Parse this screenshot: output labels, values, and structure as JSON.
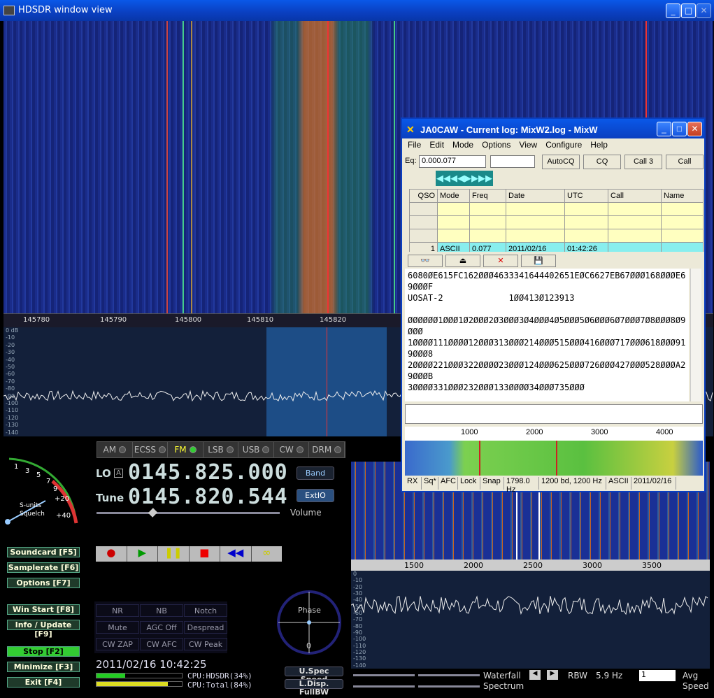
{
  "window": {
    "title": "HDSDR window view"
  },
  "waterfall_scale": [
    "145780",
    "145790",
    "145800",
    "145810",
    "145820"
  ],
  "spectrum_axis": [
    "0 dB",
    "-10",
    "-20",
    "-30",
    "-40",
    "-50",
    "-60",
    "-70",
    "-80",
    "-90",
    "-100",
    "-110",
    "-120",
    "-130",
    "-140"
  ],
  "modes": [
    {
      "label": "AM",
      "active": false
    },
    {
      "label": "ECSS",
      "active": false
    },
    {
      "label": "FM",
      "active": true
    },
    {
      "label": "LSB",
      "active": false
    },
    {
      "label": "USB",
      "active": false
    },
    {
      "label": "CW",
      "active": false
    },
    {
      "label": "DRM",
      "active": false
    }
  ],
  "lo": {
    "label": "LO",
    "lock": "A",
    "value": "0145.825.000"
  },
  "tune": {
    "label": "Tune",
    "value": "0145.820.544"
  },
  "band_button": "Band",
  "extio_button": "ExtIO",
  "volume_label": "Volume",
  "smeter": {
    "label1": "S-units",
    "label2": "Squelch",
    "scale": [
      "1",
      "3",
      "5",
      "7",
      "9",
      "+20",
      "+40"
    ]
  },
  "side_buttons": [
    {
      "label": "Soundcard  [F5]"
    },
    {
      "label": "Samplerate  [F6]"
    },
    {
      "label": "Options  [F7]"
    },
    {
      "label": "Win Start  [F8]"
    },
    {
      "label": "Info / Update  [F9]"
    },
    {
      "label": "Stop  [F2]"
    },
    {
      "label": "Minimize  [F3]"
    },
    {
      "label": "Exit  [F4]"
    }
  ],
  "dsp": [
    [
      "NR",
      "NB",
      "Notch"
    ],
    [
      "Mute",
      "AGC Off",
      "Despread"
    ],
    [
      "CW ZAP",
      "CW AFC",
      "CW Peak"
    ]
  ],
  "phase": {
    "label": "Phase",
    "zero": "0"
  },
  "datetime": "2011/02/16 10:42:25",
  "cpu": {
    "hdsdr": "CPU:HDSDR(34%)",
    "total": "CPU:Total(84%)"
  },
  "speed_buttons": {
    "u": "U.Spec Speed",
    "l": "L.Disp. FullBW"
  },
  "af_scale": [
    "1500",
    "2000",
    "2500",
    "3000",
    "3500"
  ],
  "af_axis": [
    "0",
    "-10",
    "-20",
    "-30",
    "-40",
    "-50",
    "-60",
    "-70",
    "-80",
    "-90",
    "-100",
    "-110",
    "-120",
    "-130",
    "-140"
  ],
  "bottom": {
    "waterfall": "Waterfall",
    "spectrum": "Spectrum",
    "rbw": "RBW",
    "rbw_value": "5.9 Hz",
    "avg_value": "1",
    "avg": "Avg",
    "speed": "Speed"
  },
  "mixw": {
    "title": "JA0CAW - Current log: MixW2.log - MixW",
    "menu": [
      "File",
      "Edit",
      "Mode",
      "Options",
      "View",
      "Configure",
      "Help"
    ],
    "eq_label": "Eq:",
    "eq_value": "0.000.077",
    "buttons": [
      "AutoCQ",
      "CQ",
      "Call 3",
      "Call"
    ],
    "log_headers": [
      "QSO",
      "Mode",
      "Freq",
      "Date",
      "UTC",
      "Call",
      "Name"
    ],
    "log_row": {
      "qso": "1",
      "mode": "ASCII",
      "freq": "0.077",
      "date": "2011/02/16",
      "utc": "01:42:26"
    },
    "rx_text": "6080ØE615FC162ØØØ4633341644402651EØC6627EB67ØØØ168ØØØE69ØØØF\nUOSAT-2             1ØØ413Ø123913\n\nØØØØØØ1ØØØ1Ø2ØØØ2Ø3ØØØ3Ø4ØØØ4Ø5ØØØ5Ø6ØØØ6Ø7ØØØ7Ø8ØØØ8Ø9ØØØ\n1ØØØØ111ØØØØ12ØØØ313ØØØ214ØØØ515ØØØ416ØØØ717ØØØ618ØØØ919ØØØ8\n2ØØØØ221ØØØ322ØØØØ23ØØØ124ØØØ625ØØØ726ØØØ427ØØØ528ØØØA29ØØØB\n3ØØØØ331ØØØ232ØØØ133ØØØØ34ØØØ735ØØØ",
    "scale": [
      "1000",
      "2000",
      "3000",
      "4000"
    ],
    "status": [
      "RX",
      "Sq*",
      "AFC",
      "Lock",
      "Snap",
      "1798.0 Hz",
      "1200 bd, 1200 Hz",
      "ASCII",
      "2011/02/16"
    ]
  }
}
